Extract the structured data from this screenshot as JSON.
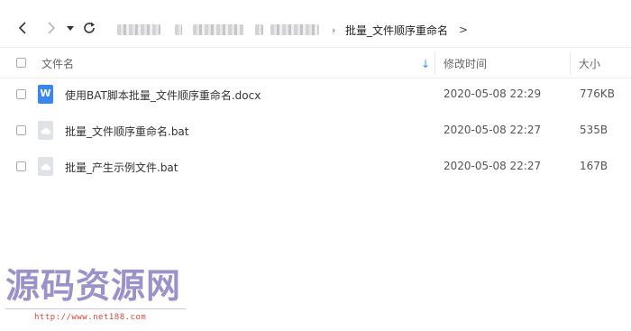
{
  "nav": {
    "current_folder": "批量_文件顺序重命名",
    "next_arrow": ">",
    "sep": "›"
  },
  "header": {
    "name_label": "文件名",
    "date_label": "修改时间",
    "size_label": "大小",
    "sort_arrow": "↓"
  },
  "files": [
    {
      "name": "使用BAT脚本批量_文件顺序重命名.docx",
      "date": "2020-05-08 22:29",
      "size": "776KB",
      "icon": "word-doc-icon",
      "icon_letter": "W"
    },
    {
      "name": "批量_文件顺序重命名.bat",
      "date": "2020-05-08 22:27",
      "size": "535B",
      "icon": "bat-file-icon"
    },
    {
      "name": "批量_产生示例文件.bat",
      "date": "2020-05-08 22:27",
      "size": "167B",
      "icon": "bat-file-icon"
    }
  ],
  "watermark": {
    "text": "源码资源网",
    "url": "http://www.net188.com"
  },
  "colors": {
    "accent": "#3b8bf3",
    "word_icon": "#3a85f0",
    "bat_icon": "#dfe3e8",
    "watermark": "#8d83c4",
    "watermark_url": "#d4453b"
  }
}
